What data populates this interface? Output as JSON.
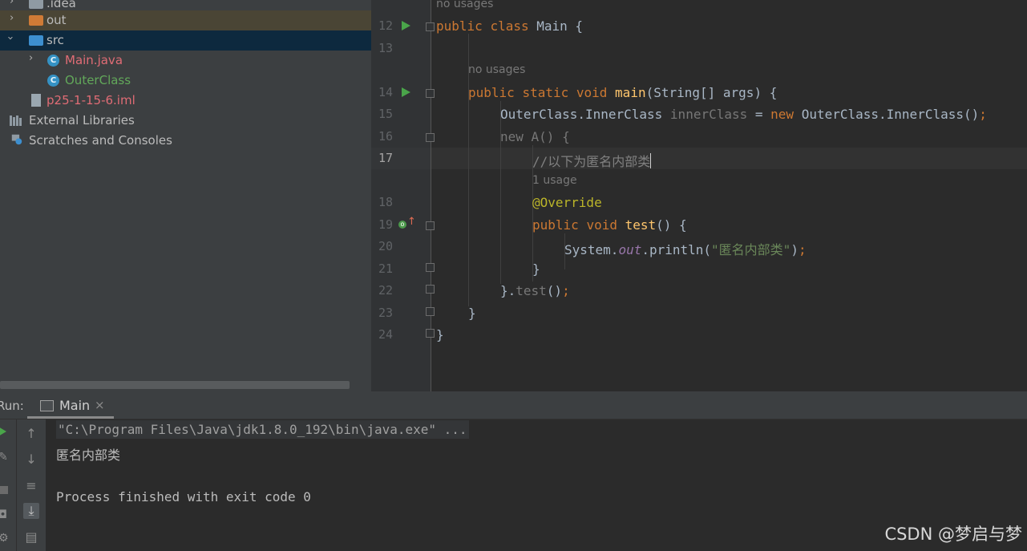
{
  "project_tree": {
    "items": [
      {
        "label": ".idea"
      },
      {
        "label": "out"
      },
      {
        "label": "src"
      },
      {
        "label": "Main.java"
      },
      {
        "label": "OuterClass"
      },
      {
        "label": "p25-1-15-6.iml"
      },
      {
        "label": "External Libraries"
      },
      {
        "label": "Scratches and Consoles"
      }
    ]
  },
  "editor": {
    "hints": {
      "no_usages_class": "no usages",
      "no_usages_main": "no usages",
      "one_usage": "1 usage"
    },
    "line_numbers": [
      "12",
      "13",
      "14",
      "15",
      "16",
      "17",
      "18",
      "19",
      "20",
      "21",
      "22",
      "23",
      "24"
    ],
    "current_line": "17",
    "code": {
      "l12_kw1": "public",
      "l12_kw2": "class",
      "l12_rest": " Main {",
      "l14_kw1": "public",
      "l14_kw2": "static",
      "l14_kw3": "void",
      "l14_fn": "main",
      "l14_rest": "(String[] args) {",
      "l15_a": "OuterClass.InnerClass ",
      "l15_var": "innerClass",
      "l15_b": " = ",
      "l15_kw": "new",
      "l15_c": " OuterClass.InnerClass()",
      "l15_semi": ";",
      "l16_a": "new",
      "l16_b": " A() {",
      "l17_cmt": "//以下为匿名内部类",
      "l18_ann": "@Override",
      "l19_kw1": "public",
      "l19_kw2": "void",
      "l19_fn": "test",
      "l19_rest": "() {",
      "l20_a": "System.",
      "l20_fld": "out",
      "l20_b": ".println(",
      "l20_str": "\"匿名内部类\"",
      "l20_c": ")",
      "l20_semi": ";",
      "l21": "}",
      "l22_a": "}.",
      "l22_b": "test",
      "l22_c": "()",
      "l22_semi": ";",
      "l23": "}",
      "l24": "}"
    }
  },
  "run_panel": {
    "label": "Run:",
    "tab_label": "Main",
    "tab_close": "×",
    "output": {
      "command": "\"C:\\Program Files\\Java\\jdk1.8.0_192\\bin\\java.exe\" ...",
      "line1": "匿名内部类",
      "line2": "Process finished with exit code 0"
    }
  },
  "watermark": "CSDN @梦启与梦",
  "colors": {
    "keyword": "#cc7832",
    "function": "#ffc66d",
    "string": "#6a8759",
    "comment": "#808080",
    "annotation": "#bbb529",
    "main_java_error": "#e06c75",
    "outer_class": "#62a85a",
    "iml_file": "#e06c75"
  }
}
